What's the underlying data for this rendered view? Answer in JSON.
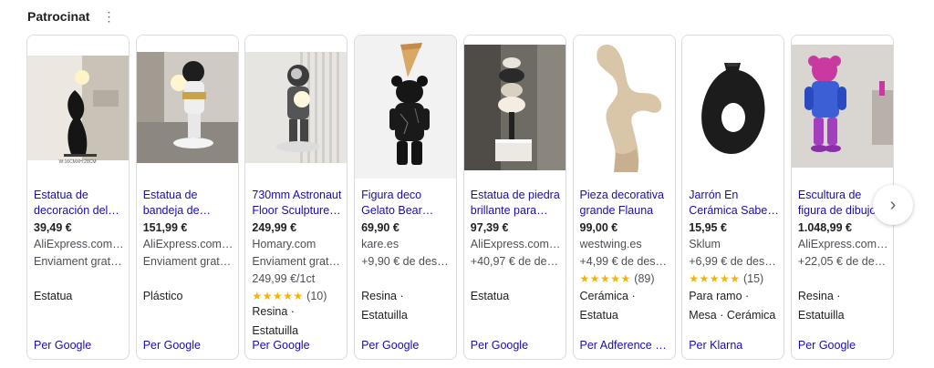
{
  "header": {
    "title": "Patrocinat",
    "menu_icon": "⋮"
  },
  "products": [
    {
      "name": "Estatua de decoración del…",
      "price": "39,49 €",
      "store": "AliExpress.com…",
      "shipping": "Enviament grat…",
      "attrs": [
        "Estatua"
      ],
      "provider": "Per Google",
      "image_caption": "W:16CMXH:28CM"
    },
    {
      "name": "Estatua de bandeja de…",
      "price": "151,99 €",
      "store": "AliExpress.com…",
      "shipping": "Enviament grat…",
      "attrs": [
        "Plástico"
      ],
      "provider": "Per Google"
    },
    {
      "name": "730mm Astronaut Floor Sculpture…",
      "price": "249,99 €",
      "store": "Homary.com",
      "shipping": "Enviament grat…",
      "unit_price": "249,99 €/1ct",
      "rating": "(10)",
      "stars": "★★★★★",
      "attrs": [
        "Resina ·",
        "Estatuilla"
      ],
      "provider": "Per Google"
    },
    {
      "name": "Figura deco Gelato Bear…",
      "price": "69,90 €",
      "store": "kare.es",
      "shipping": "+9,90 € de des…",
      "attrs": [
        "Resina ·",
        "Estatuilla"
      ],
      "provider": "Per Google"
    },
    {
      "name": "Estatua de piedra brillante para…",
      "price": "97,39 €",
      "store": "AliExpress.com…",
      "shipping": "+40,97 € de des…",
      "attrs": [
        "Estatua"
      ],
      "provider": "Per Google"
    },
    {
      "name": "Pieza decorativa grande Flauna",
      "price": "99,00 €",
      "store": "westwing.es",
      "shipping": "+4,99 € de des…",
      "rating": "(89)",
      "stars": "★★★★★",
      "attrs": [
        "Cerámica ·",
        "Estatua"
      ],
      "provider": "Per Adference …"
    },
    {
      "name": "Jarrón En Cerámica Sabe…",
      "price": "15,95 €",
      "store": "Sklum",
      "shipping": "+6,99 € de des…",
      "rating": "(15)",
      "stars": "★★★★★",
      "attrs": [
        "Para ramo ·",
        "Mesa · Cerámica"
      ],
      "provider": "Per Klarna"
    },
    {
      "name": "Escultura de figura de dibujo…",
      "price": "1.048,99 €",
      "store": "AliExpress.com…",
      "shipping": "+22,05 € de des…",
      "attrs": [
        "Resina ·",
        "Estatuilla"
      ],
      "provider": "Per Google"
    }
  ],
  "next_icon": "›",
  "colors": {
    "link": "#1a0dab",
    "star": "#f4b400",
    "border": "#dadce0"
  }
}
